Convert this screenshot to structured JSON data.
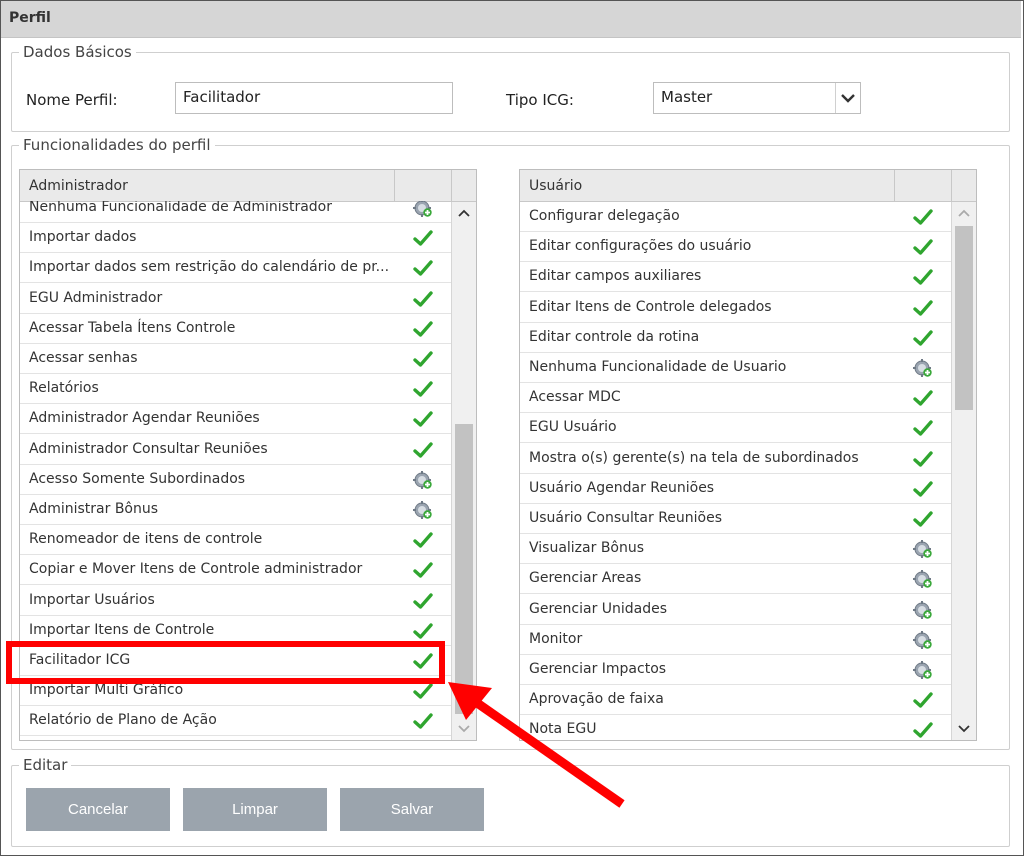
{
  "window": {
    "title": "Perfil"
  },
  "dados_basicos": {
    "legend": "Dados Básicos",
    "nome_label": "Nome Perfil:",
    "nome_value": "Facilitador",
    "tipo_label": "Tipo ICG:",
    "tipo_value": "Master"
  },
  "funcionalidades": {
    "legend": "Funcionalidades do perfil",
    "admin": {
      "header": "Administrador",
      "rows": [
        {
          "label": "Nenhuma Funcionalidade de Administrador",
          "icon": "gear-add-icon"
        },
        {
          "label": "Importar dados",
          "icon": "check-icon"
        },
        {
          "label": "Importar dados sem restrição do calendário de pr...",
          "icon": "check-icon"
        },
        {
          "label": "EGU Administrador",
          "icon": "check-icon"
        },
        {
          "label": "Acessar Tabela Ítens Controle",
          "icon": "check-icon"
        },
        {
          "label": "Acessar senhas",
          "icon": "check-icon"
        },
        {
          "label": "Relatórios",
          "icon": "check-icon"
        },
        {
          "label": "Administrador Agendar Reuniões",
          "icon": "check-icon"
        },
        {
          "label": "Administrador Consultar Reuniões",
          "icon": "check-icon"
        },
        {
          "label": "Acesso Somente Subordinados",
          "icon": "gear-add-icon"
        },
        {
          "label": "Administrar Bônus",
          "icon": "gear-add-icon"
        },
        {
          "label": "Renomeador de itens de controle",
          "icon": "check-icon"
        },
        {
          "label": "Copiar e Mover Itens de Controle administrador",
          "icon": "check-icon"
        },
        {
          "label": "Importar Usuários",
          "icon": "check-icon"
        },
        {
          "label": "Importar Itens de Controle",
          "icon": "check-icon"
        },
        {
          "label": "Facilitador ICG",
          "icon": "check-icon"
        },
        {
          "label": "Importar Multi Gráfico",
          "icon": "check-icon"
        },
        {
          "label": "Relatório de Plano de Ação",
          "icon": "check-icon"
        }
      ]
    },
    "usuario": {
      "header": "Usuário",
      "rows": [
        {
          "label": "Configurar delegação",
          "icon": "check-icon"
        },
        {
          "label": "Editar configurações do usuário",
          "icon": "check-icon"
        },
        {
          "label": "Editar campos auxiliares",
          "icon": "check-icon"
        },
        {
          "label": "Editar Itens de Controle delegados",
          "icon": "check-icon"
        },
        {
          "label": "Editar controle da rotina",
          "icon": "check-icon"
        },
        {
          "label": "Nenhuma Funcionalidade de Usuario",
          "icon": "gear-add-icon"
        },
        {
          "label": "Acessar MDC",
          "icon": "check-icon"
        },
        {
          "label": "EGU Usuário",
          "icon": "check-icon"
        },
        {
          "label": "Mostra o(s) gerente(s) na tela de subordinados",
          "icon": "check-icon"
        },
        {
          "label": "Usuário Agendar Reuniões",
          "icon": "check-icon"
        },
        {
          "label": "Usuário Consultar Reuniões",
          "icon": "check-icon"
        },
        {
          "label": "Visualizar Bônus",
          "icon": "gear-add-icon"
        },
        {
          "label": "Gerenciar Areas",
          "icon": "gear-add-icon"
        },
        {
          "label": "Gerenciar Unidades",
          "icon": "gear-add-icon"
        },
        {
          "label": "Monitor",
          "icon": "gear-add-icon"
        },
        {
          "label": "Gerenciar Impactos",
          "icon": "gear-add-icon"
        },
        {
          "label": "Aprovação de faixa",
          "icon": "check-icon"
        },
        {
          "label": "Nota EGU",
          "icon": "check-icon"
        }
      ]
    }
  },
  "editar": {
    "legend": "Editar",
    "cancel_label": "Cancelar",
    "clear_label": "Limpar",
    "save_label": "Salvar"
  },
  "colors": {
    "check": "#2fa52f",
    "highlight": "#ff0000",
    "button": "#9ba4ad",
    "titlebar": "#d6d6d6"
  }
}
